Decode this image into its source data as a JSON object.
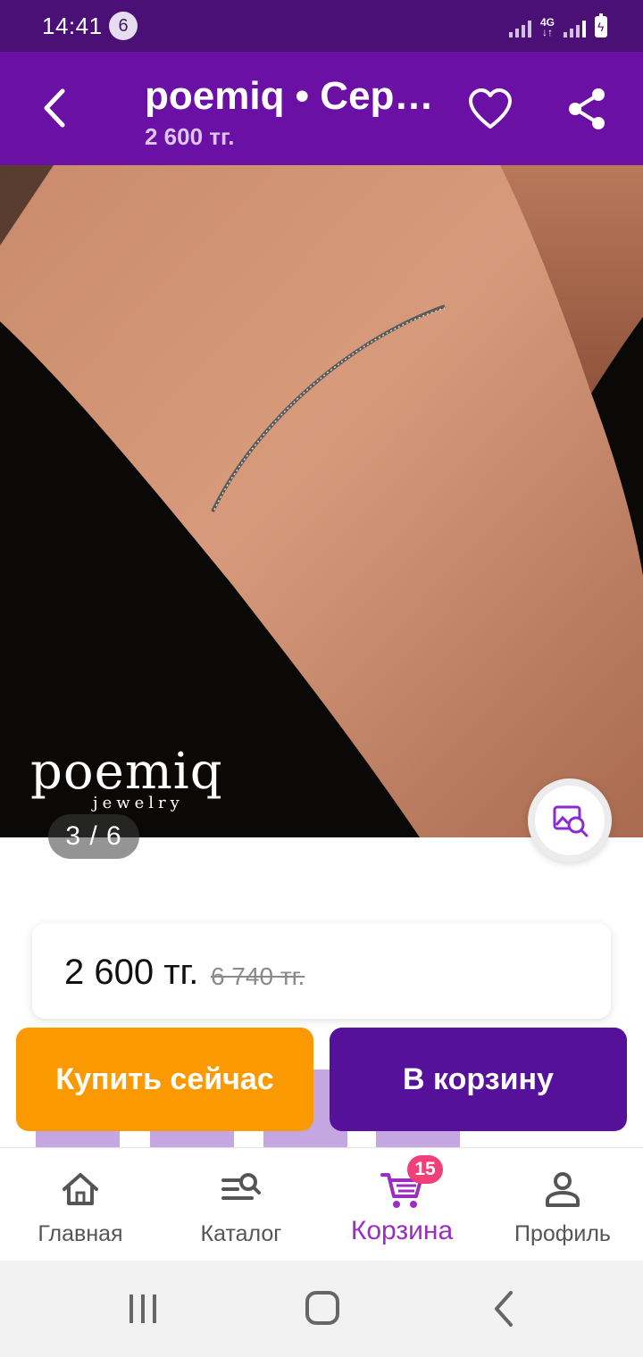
{
  "status_bar": {
    "time": "14:41",
    "notification_count": "6",
    "network_label": "4G"
  },
  "app_bar": {
    "title": "poemiq • Серебряный браслет",
    "subtitle": "2 600 тг."
  },
  "gallery": {
    "counter": "3 / 6",
    "brand_logo": "poemiq",
    "brand_sub": "jewelry"
  },
  "price": {
    "current": "2 600 тг.",
    "old": "6 740 тг."
  },
  "actions": {
    "buy_now": "Купить сейчас",
    "add_to_cart": "В корзину"
  },
  "bottom_nav": {
    "items": [
      {
        "label": "Главная",
        "icon": "home-icon"
      },
      {
        "label": "Каталог",
        "icon": "catalog-search-icon"
      },
      {
        "label": "Корзина",
        "icon": "cart-icon",
        "badge": "15",
        "active": true
      },
      {
        "label": "Профиль",
        "icon": "profile-icon"
      }
    ]
  },
  "colors": {
    "status_bar": "#4a1075",
    "app_bar": "#6a10a5",
    "buy_button": "#fb9a00",
    "cart_button": "#56119a",
    "active_nav": "#9a2ec0",
    "badge": "#f0407a"
  }
}
